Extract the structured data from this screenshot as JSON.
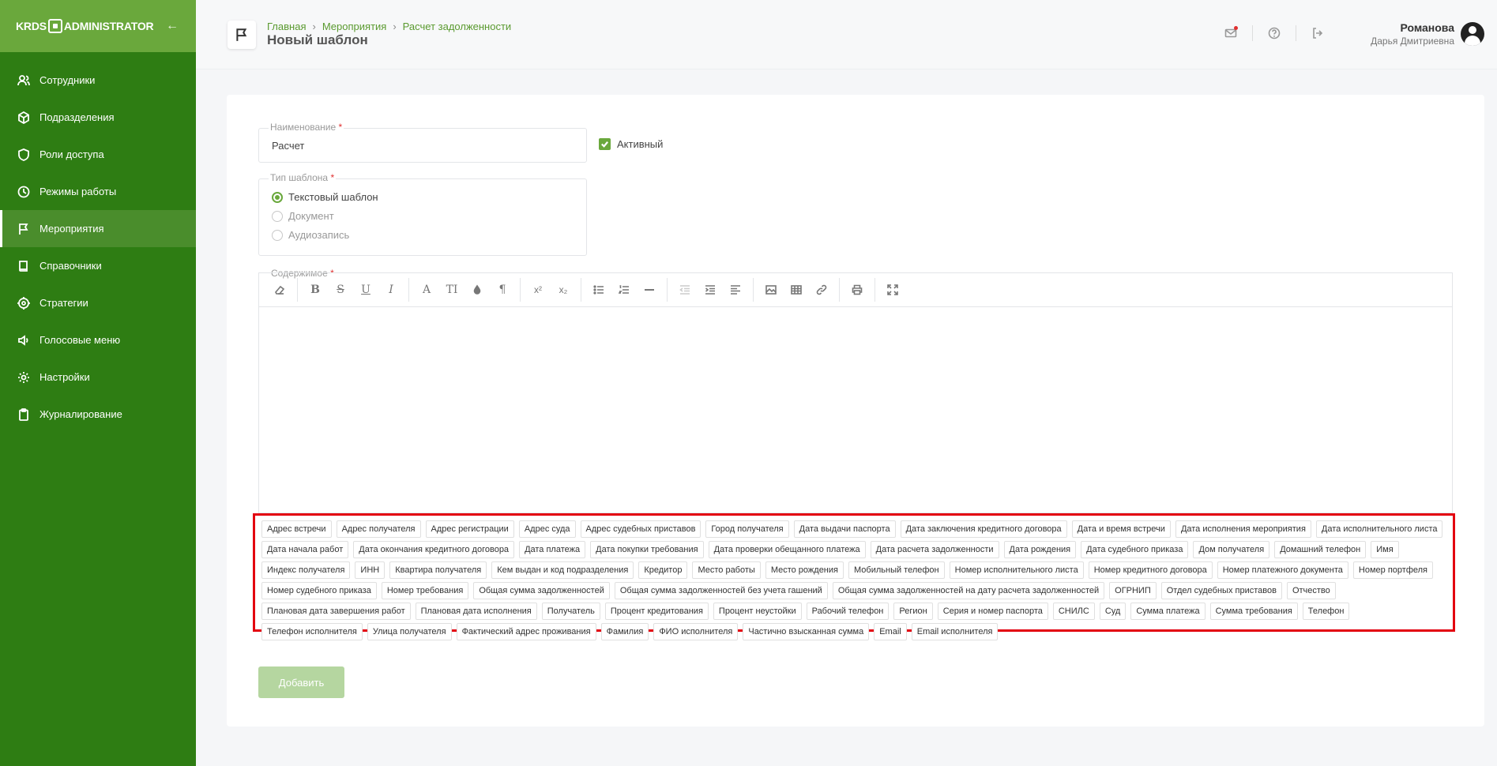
{
  "sidebar": {
    "logo_left": "KRDS",
    "logo_right": "ADMINISTRATOR",
    "collapse_icon": "arrow-left-icon",
    "items": [
      {
        "label": "Сотрудники",
        "icon": "users-icon"
      },
      {
        "label": "Подразделения",
        "icon": "cube-icon"
      },
      {
        "label": "Роли доступа",
        "icon": "shield-icon"
      },
      {
        "label": "Режимы работы",
        "icon": "clock-icon"
      },
      {
        "label": "Мероприятия",
        "icon": "flag-icon",
        "active": true
      },
      {
        "label": "Справочники",
        "icon": "book-icon"
      },
      {
        "label": "Стратегии",
        "icon": "target-icon"
      },
      {
        "label": "Голосовые меню",
        "icon": "speaker-icon"
      },
      {
        "label": "Настройки",
        "icon": "gear-icon"
      },
      {
        "label": "Журналирование",
        "icon": "clipboard-icon"
      }
    ]
  },
  "header": {
    "breadcrumb": [
      "Главная",
      "Мероприятия",
      "Расчет задолженности"
    ],
    "title": "Новый шаблон",
    "user_last": "Романова",
    "user_first": "Дарья Дмитриевна"
  },
  "form": {
    "name_label": "Наименование",
    "name_value": "Расчет",
    "active_label": "Активный",
    "active_checked": true,
    "type_label": "Тип шаблона",
    "type_options": [
      "Текстовый шаблон",
      "Документ",
      "Аудиозапись"
    ],
    "type_selected": "Текстовый шаблон",
    "content_label": "Содержимое",
    "submit_label": "Добавить"
  },
  "variables": [
    "Адрес встречи",
    "Адрес получателя",
    "Адрес регистрации",
    "Адрес суда",
    "Адрес судебных приставов",
    "Город получателя",
    "Дата выдачи паспорта",
    "Дата заключения кредитного договора",
    "Дата и время встречи",
    "Дата исполнения мероприятия",
    "Дата исполнительного листа",
    "Дата начала работ",
    "Дата окончания кредитного договора",
    "Дата платежа",
    "Дата покупки требования",
    "Дата проверки обещанного платежа",
    "Дата расчета задолженности",
    "Дата рождения",
    "Дата судебного приказа",
    "Дом получателя",
    "Домашний телефон",
    "Имя",
    "Индекс получателя",
    "ИНН",
    "Квартира получателя",
    "Кем выдан и код подразделения",
    "Кредитор",
    "Место работы",
    "Место рождения",
    "Мобильный телефон",
    "Номер исполнительного листа",
    "Номер кредитного договора",
    "Номер платежного документа",
    "Номер портфеля",
    "Номер судебного приказа",
    "Номер требования",
    "Общая сумма задолженностей",
    "Общая сумма задолженностей без учета гашений",
    "Общая сумма задолженностей на дату расчета задолженностей",
    "ОГРНИП",
    "Отдел судебных приставов",
    "Отчество",
    "Плановая дата завершения работ",
    "Плановая дата исполнения",
    "Получатель",
    "Процент кредитования",
    "Процент неустойки",
    "Рабочий телефон",
    "Регион",
    "Серия и номер паспорта",
    "СНИЛС",
    "Суд",
    "Сумма платежа",
    "Сумма требования",
    "Телефон",
    "Телефон исполнителя",
    "Улица получателя",
    "Фактический адрес проживания",
    "Фамилия",
    "ФИО исполнителя",
    "Частично взысканная сумма",
    "Email",
    "Email исполнителя"
  ],
  "toolbar": {
    "bold": "B",
    "strike": "S",
    "underline": "U",
    "italic": "I",
    "font": "A",
    "size": "TI",
    "para": "¶",
    "sup": "x²",
    "sub": "x₂"
  },
  "colors": {
    "sidebar": "#2e7d13",
    "sidebar_head": "#6aa83c",
    "accent": "#6aa83c",
    "highlight": "#e3000f"
  }
}
